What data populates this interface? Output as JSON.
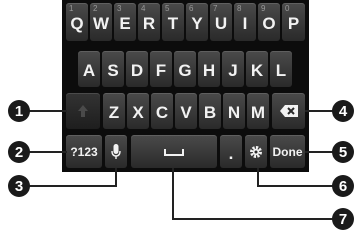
{
  "keyboard": {
    "row1": [
      {
        "label": "Q",
        "sub": "1"
      },
      {
        "label": "W",
        "sub": "2"
      },
      {
        "label": "E",
        "sub": "3"
      },
      {
        "label": "R",
        "sub": "4"
      },
      {
        "label": "T",
        "sub": "5"
      },
      {
        "label": "Y",
        "sub": "6"
      },
      {
        "label": "U",
        "sub": "7"
      },
      {
        "label": "I",
        "sub": "8"
      },
      {
        "label": "O",
        "sub": "9"
      },
      {
        "label": "P",
        "sub": "0"
      }
    ],
    "row2": [
      "A",
      "S",
      "D",
      "F",
      "G",
      "H",
      "J",
      "K",
      "L"
    ],
    "row3": [
      "Z",
      "X",
      "C",
      "V",
      "B",
      "N",
      "M"
    ],
    "symbols_label": "?123",
    "period_label": ".",
    "done_label": "Done"
  },
  "callouts": [
    "1",
    "2",
    "3",
    "4",
    "5",
    "6",
    "7"
  ],
  "colors": {
    "keyboard_bg": "#0c0c0c",
    "key_face": "#3a3a3a",
    "key_text": "#f2f2f2",
    "badge_bg": "#1a1a1a"
  }
}
